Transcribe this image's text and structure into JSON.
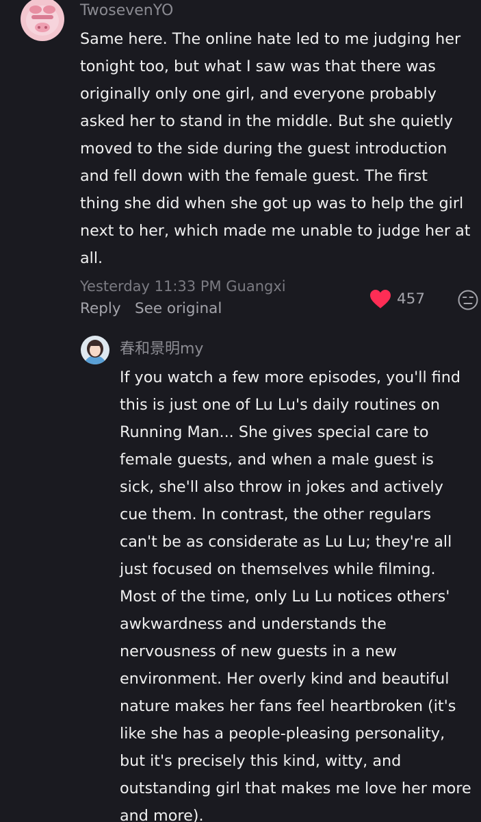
{
  "colors": {
    "background": "#1a1a20",
    "text": "#f0f0f0",
    "muted": "#8b8b92",
    "like": "#ff2d55"
  },
  "comment": {
    "username": "TwosevenYO",
    "avatar_icon": "pink-plush-avatar",
    "text": "Same here. The online hate led to me judging her\ntonight too, but what I saw was that there was\noriginally only one girl, and everyone probably\nasked her to stand in the middle. But she quietly\nmoved to the side during the guest introduction\nand fell down with the female guest. The first\nthing she did when she got up was to help the girl\nnext to her, which made me unable to judge her at\nall.",
    "timestamp": "Yesterday 11:33 PM Guangxi",
    "reply_label": "Reply",
    "see_original_label": "See original",
    "like_count": "457",
    "like_icon": "heart-icon",
    "dislike_icon": "dislike-face-icon"
  },
  "reply": {
    "username": "春和景明my",
    "avatar_icon": "girl-portrait-avatar",
    "text": "If you watch a few more episodes, you'll find\nthis is just one of Lu Lu's daily routines on\nRunning Man... She gives special care to\nfemale guests, and when a male guest is\nsick, she'll also throw in jokes and actively\ncue them. In contrast, the other regulars\ncan't be as considerate as Lu Lu; they're all\njust focused on themselves while filming.\nMost of the time, only Lu Lu notices others'\nawkwardness and understands the\nnervousness of new guests in a new\nenvironment. Her overly kind and beautiful\nnature makes her fans feel heartbroken (it's\nlike she has a people-pleasing personality,\nbut it's precisely this kind, witty, and\noutstanding girl that makes me love her more\nand more)."
  }
}
